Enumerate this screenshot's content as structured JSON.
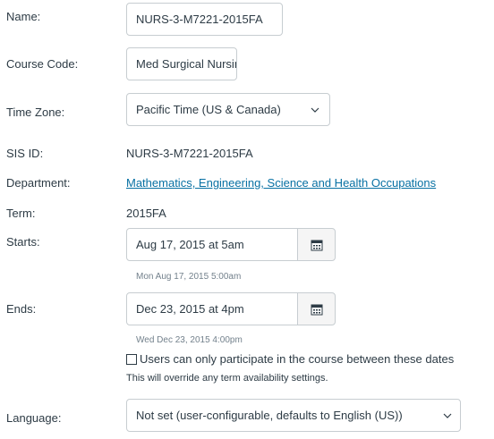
{
  "name": {
    "label": "Name:",
    "value": "NURS-3-M7221-2015FA"
  },
  "course_code": {
    "label": "Course Code:",
    "value": "Med Surgical Nursing"
  },
  "time_zone": {
    "label": "Time Zone:",
    "value": "Pacific Time (US & Canada)"
  },
  "sis_id": {
    "label": "SIS ID:",
    "value": "NURS-3-M7221-2015FA"
  },
  "department": {
    "label": "Department:",
    "value": "Mathematics, Engineering, Science and Health Occupations"
  },
  "term": {
    "label": "Term:",
    "value": "2015FA"
  },
  "starts": {
    "label": "Starts:",
    "value": "Aug 17, 2015 at  5am",
    "hint": "Mon Aug 17, 2015 5:00am",
    "icon": "calendar-icon"
  },
  "ends": {
    "label": "Ends:",
    "value": "Dec 23, 2015 at  4pm",
    "hint": "Wed Dec 23, 2015 4:00pm",
    "icon": "calendar-icon"
  },
  "restrict": {
    "checkbox_label": "Users can only participate in the course between these dates",
    "checked": false,
    "note": "This will override any term availability settings."
  },
  "language": {
    "label": "Language:",
    "value": "Not set (user-configurable, defaults to English (US))"
  },
  "colors": {
    "text": "#2d3b45",
    "link": "#0770a3",
    "border": "#c7cdd1",
    "hint": "#73818c"
  }
}
